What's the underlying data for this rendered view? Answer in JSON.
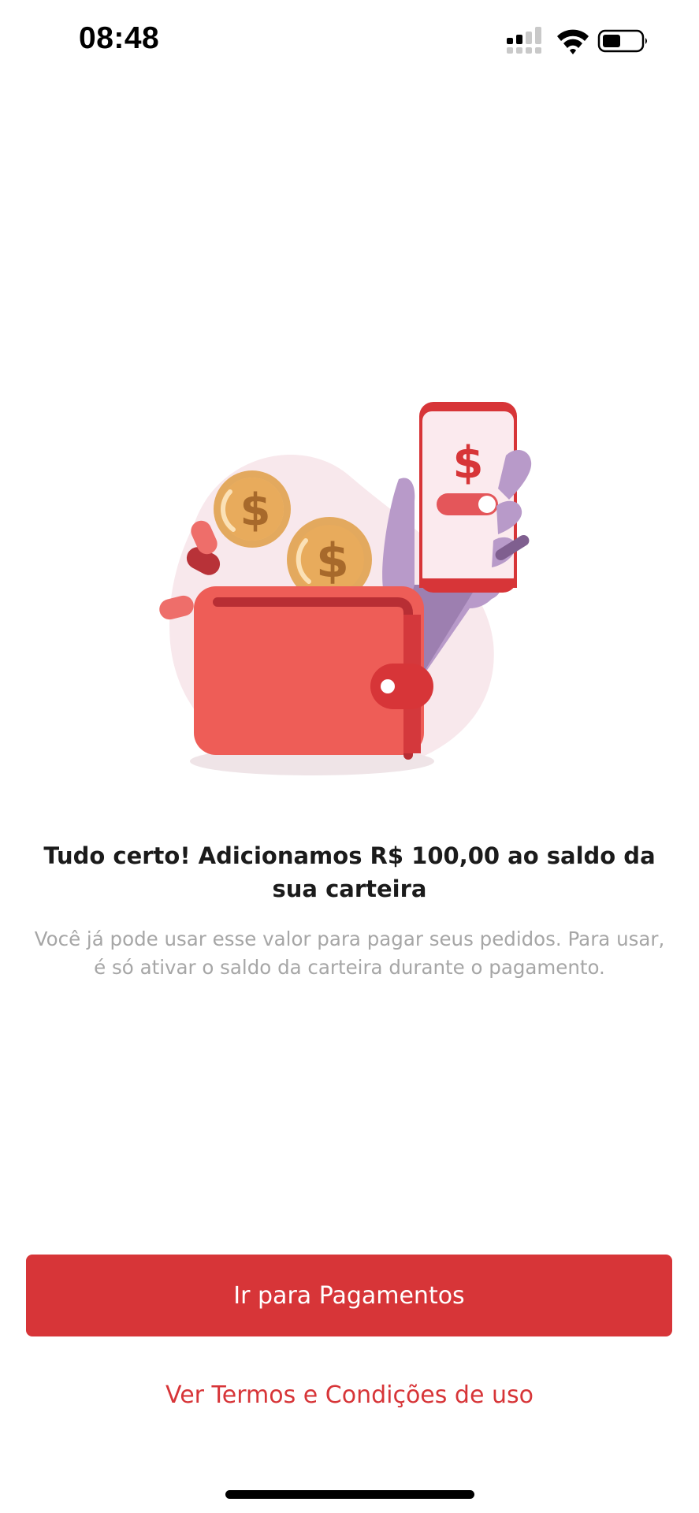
{
  "status_bar": {
    "time": "08:48",
    "icons": [
      "cellular-signal-icon",
      "wifi-icon",
      "battery-icon"
    ]
  },
  "illustration": {
    "name": "wallet-with-coins-and-phone-illustration"
  },
  "content": {
    "headline": "Tudo certo! Adicionamos R$ 100,00 ao saldo da sua carteira",
    "description": "Você já pode usar esse valor para pagar seus pedidos. Para usar, é só ativar o saldo da carteira durante o pagamento."
  },
  "actions": {
    "primary_label": "Ir para Pagamentos",
    "terms_label": "Ver Termos e Condições de uso"
  },
  "colors": {
    "brand_red": "#d73538",
    "headline_text": "#1b1b1b",
    "secondary_text": "#a6a6a6"
  }
}
